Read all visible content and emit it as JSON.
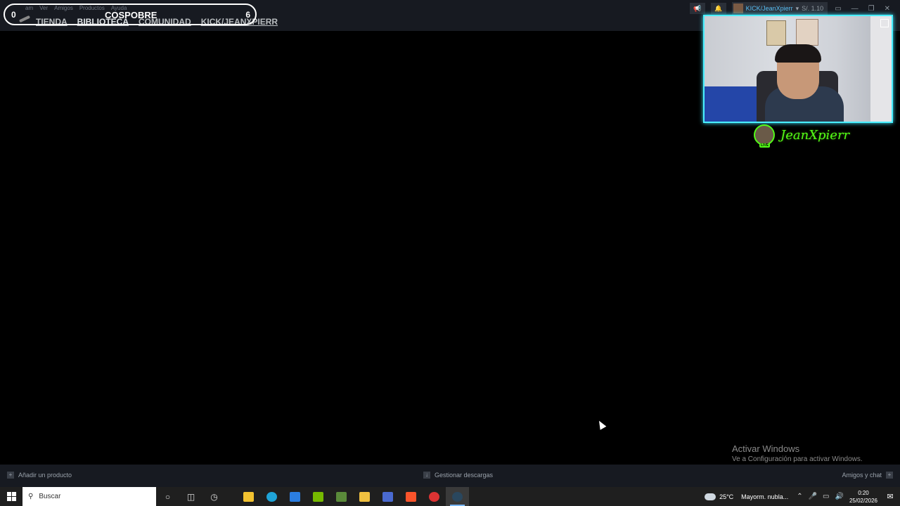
{
  "menu": [
    "am",
    "Ver",
    "Amigos",
    "Productos",
    "Ayuda"
  ],
  "nav": [
    "TIENDA",
    "BIBLIOTECA",
    "COMUNIDAD",
    "KICK/JEANXPIERR"
  ],
  "scoreboard": {
    "left": "0",
    "title": "COSPOBRE",
    "right": "6"
  },
  "user": {
    "name": "KICK/JeanXpierr",
    "balance": "S/. 1.10"
  },
  "streamer": {
    "name": "JeanXpierr",
    "live": "LIVE"
  },
  "watermark": {
    "line1": "Activar Windows",
    "line2": "Ve a Configuración para activar Windows."
  },
  "bottombar": {
    "add": "Añadir un producto",
    "downloads": "Gestionar descargas",
    "friends": "Amigos y chat"
  },
  "taskbar": {
    "search_placeholder": "Buscar",
    "weather": "25°C",
    "weather_desc": "Mayorm. nubla...",
    "time": "0:20",
    "date": "25/02/2026"
  },
  "colors": {
    "accent": "#53fc18",
    "webcam_border": "#4af0ff",
    "steam_bg": "#171a21",
    "user_link": "#59bff5"
  },
  "icons": [
    "megaphone-icon",
    "bell-icon",
    "chevron-down-icon",
    "monitor-icon",
    "minimize-icon",
    "restore-icon",
    "close-icon",
    "windows-logo-icon",
    "search-icon",
    "cortana-icon",
    "task-view-icon",
    "speed-icon",
    "store-icon",
    "edge-icon",
    "mail-icon",
    "nvidia-icon",
    "minecraft-icon",
    "folder-icon",
    "brave-icon",
    "chrome-icon",
    "steam-icon",
    "weather-icon",
    "chevron-up-icon",
    "mic-icon",
    "network-icon",
    "volume-icon",
    "notification-icon"
  ]
}
